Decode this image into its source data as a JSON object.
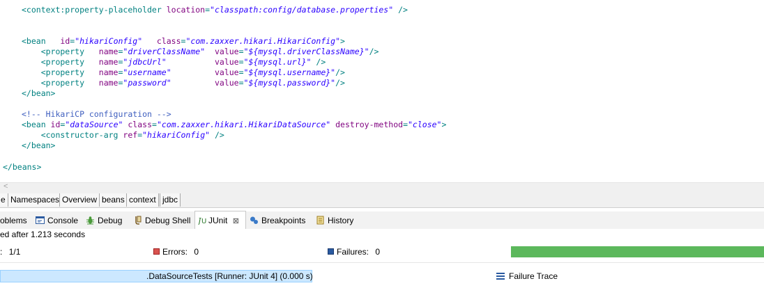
{
  "editor": {
    "lines": [
      [
        [
          "t",
          "<context:property-placeholder "
        ],
        [
          "a",
          "location"
        ],
        [
          "t",
          "="
        ],
        [
          "v",
          "\"classpath:config/database.properties\""
        ],
        [
          "t",
          " />"
        ]
      ],
      [
        [
          "t",
          "<bean   "
        ],
        [
          "a",
          "id"
        ],
        [
          "t",
          "="
        ],
        [
          "v",
          "\"hikariConfig\""
        ],
        [
          "t",
          "   "
        ],
        [
          "a",
          "class"
        ],
        [
          "t",
          "="
        ],
        [
          "v",
          "\"com.zaxxer.hikari.HikariConfig\""
        ],
        [
          "t",
          ">"
        ]
      ],
      [
        [
          "t",
          "    <property   "
        ],
        [
          "a",
          "name"
        ],
        [
          "t",
          "="
        ],
        [
          "v",
          "\"driverClassName\""
        ],
        [
          "t",
          "  "
        ],
        [
          "a",
          "value"
        ],
        [
          "t",
          "="
        ],
        [
          "v",
          "\"${mysql.driverClassName}\""
        ],
        [
          "t",
          "/>"
        ]
      ],
      [
        [
          "t",
          "    <property   "
        ],
        [
          "a",
          "name"
        ],
        [
          "t",
          "="
        ],
        [
          "v",
          "\"jdbcUrl\""
        ],
        [
          "t",
          "          "
        ],
        [
          "a",
          "value"
        ],
        [
          "t",
          "="
        ],
        [
          "v",
          "\"${mysql.url}\""
        ],
        [
          "t",
          " />"
        ]
      ],
      [
        [
          "t",
          "    <property   "
        ],
        [
          "a",
          "name"
        ],
        [
          "t",
          "="
        ],
        [
          "v",
          "\"username\""
        ],
        [
          "t",
          "         "
        ],
        [
          "a",
          "value"
        ],
        [
          "t",
          "="
        ],
        [
          "v",
          "\"${mysql.username}\""
        ],
        [
          "t",
          "/>"
        ]
      ],
      [
        [
          "t",
          "    <property   "
        ],
        [
          "a",
          "name"
        ],
        [
          "t",
          "="
        ],
        [
          "v",
          "\"password\""
        ],
        [
          "t",
          "         "
        ],
        [
          "a",
          "value"
        ],
        [
          "t",
          "="
        ],
        [
          "v",
          "\"${mysql.password}\""
        ],
        [
          "t",
          "/>"
        ]
      ],
      [
        [
          "t",
          "</bean>"
        ]
      ],
      [
        [
          "c",
          "<!-- HikariCP configuration -->"
        ]
      ],
      [
        [
          "t",
          "<bean "
        ],
        [
          "a",
          "id"
        ],
        [
          "t",
          "="
        ],
        [
          "v",
          "\"dataSource\""
        ],
        [
          "t",
          " "
        ],
        [
          "a",
          "class"
        ],
        [
          "t",
          "="
        ],
        [
          "v",
          "\"com.zaxxer.hikari.HikariDataSource\""
        ],
        [
          "t",
          " "
        ],
        [
          "a",
          "destroy-method"
        ],
        [
          "t",
          "="
        ],
        [
          "v",
          "\"close\""
        ],
        [
          "t",
          ">"
        ]
      ],
      [
        [
          "t",
          "    <constructor-arg "
        ],
        [
          "a",
          "ref"
        ],
        [
          "t",
          "="
        ],
        [
          "v",
          "\"hikariConfig\""
        ],
        [
          "t",
          " />"
        ]
      ],
      [
        [
          "t",
          "</bean>"
        ]
      ],
      [
        [
          "t",
          "</beans>"
        ]
      ]
    ]
  },
  "scroll": {
    "left_arrow": "<"
  },
  "page_tabs": [
    "e",
    "Namespaces",
    "Overview",
    "beans",
    "context",
    "jdbc"
  ],
  "views": {
    "problems": "oblems",
    "console": "Console",
    "debug": "Debug",
    "debug_shell": "Debug Shell",
    "junit": "JUnit",
    "junit_close": "⊠",
    "breakpoints": "Breakpoints",
    "history": "History"
  },
  "junit": {
    "status": "ed after 1.213 seconds",
    "runs_label": ":",
    "runs_value": "1/1",
    "errors_label": "Errors:",
    "errors_value": "0",
    "failures_label": "Failures:",
    "failures_value": "0",
    "progress": 1.0,
    "test_row": ".DataSourceTests [Runner: JUnit 4] (0.000 s)",
    "failure_trace": "Failure Trace"
  },
  "colors": {
    "tag": "#008080",
    "attribute": "#7f007f",
    "value": "#2a00ff",
    "comment": "#3f5fbf",
    "progress_ok": "#5cb85c"
  }
}
